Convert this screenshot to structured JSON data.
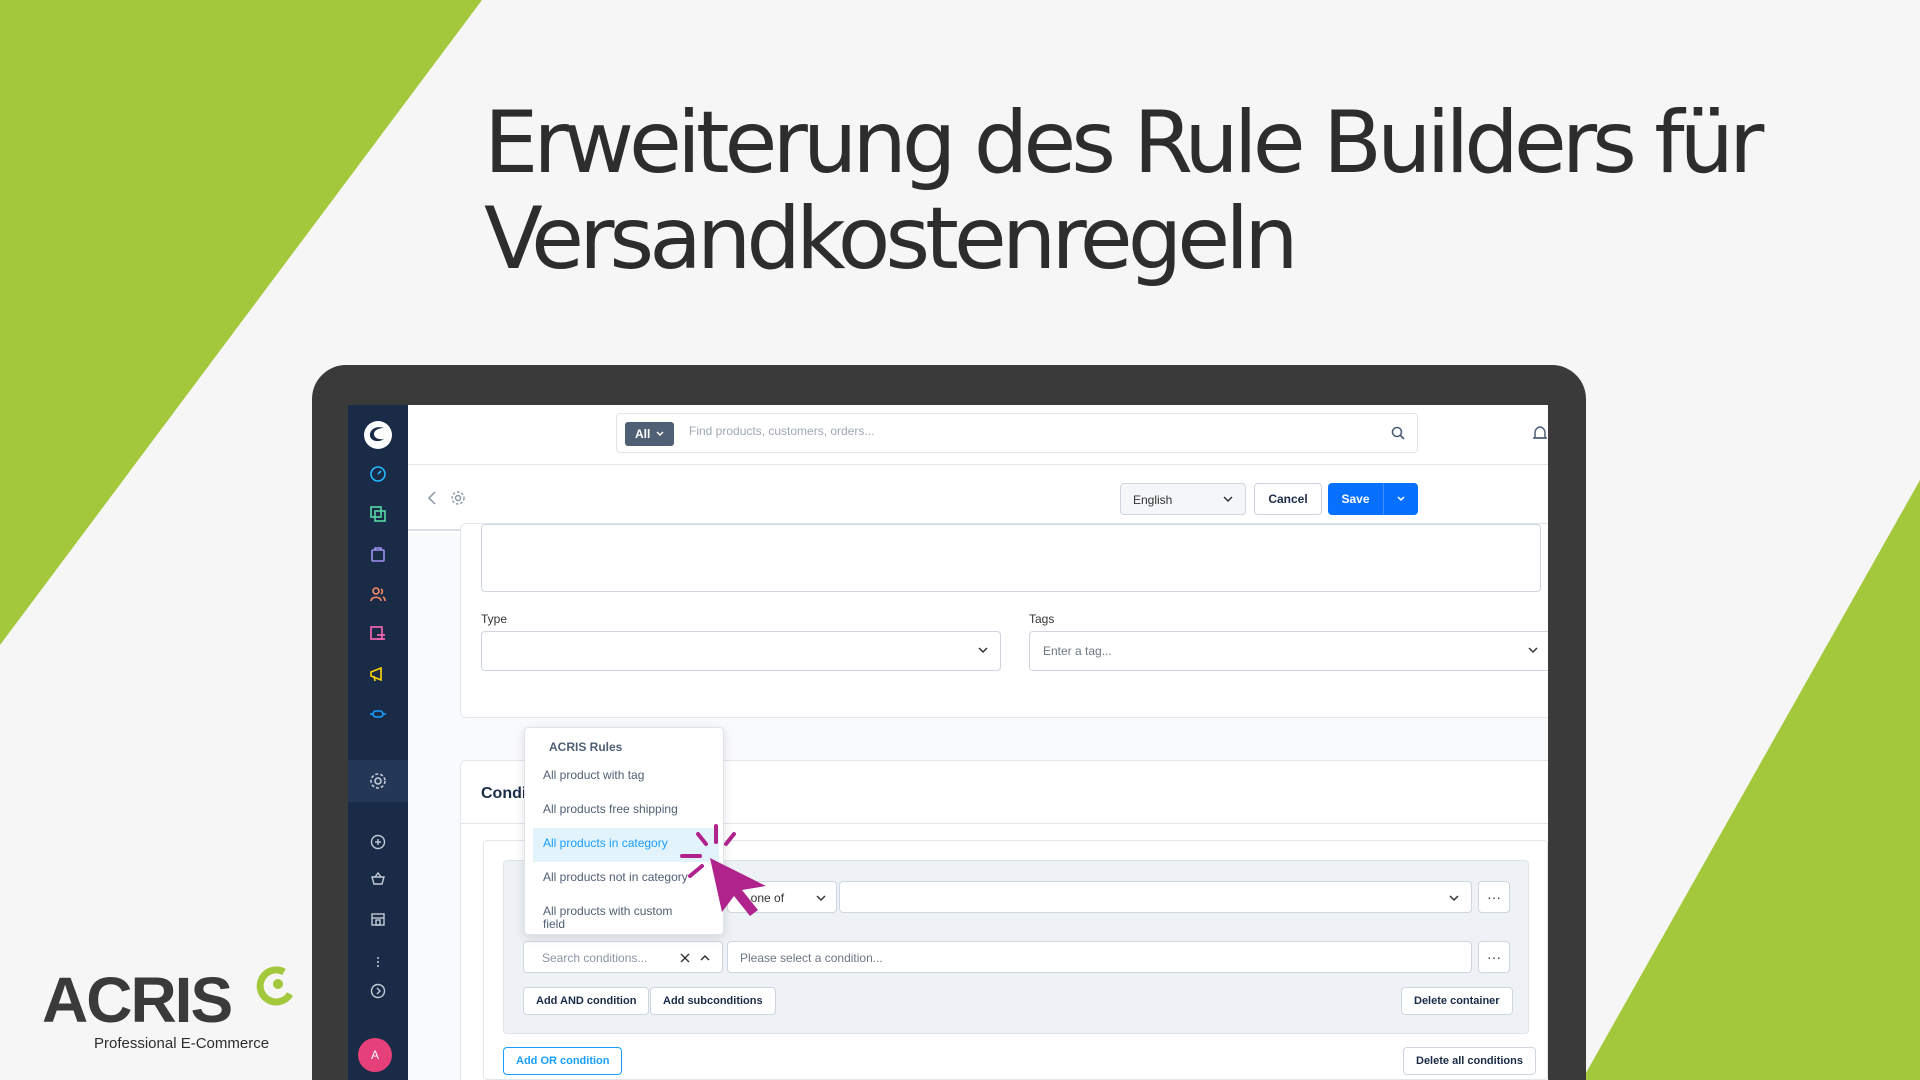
{
  "headline": {
    "line1": "Erweiterung des Rule Builders für",
    "line2": "Versandkostenregeln"
  },
  "logo": {
    "word": "ACRIS",
    "tagline": "Professional E-Commerce"
  },
  "colors": {
    "brand_green": "#a3c83b",
    "sidebar_bg": "#1a2b47",
    "primary_blue": "#0870ff",
    "cursor_magenta": "#b0238c"
  },
  "topbar": {
    "search_type": "All",
    "search_placeholder": "Find products, customers, orders..."
  },
  "smartbar": {
    "language": "English",
    "cancel_label": "Cancel",
    "save_label": "Save"
  },
  "form": {
    "type_label": "Type",
    "tags_label": "Tags",
    "tags_placeholder": "Enter a tag..."
  },
  "conditions": {
    "title": "Condi",
    "operator_value": "Is one of",
    "search_placeholder": "Search conditions...",
    "condition_placeholder": "Please select a condition...",
    "add_and_label": "Add AND condition",
    "add_sub_label": "Add subconditions",
    "delete_container_label": "Delete container",
    "add_or_label": "Add OR condition",
    "delete_all_label": "Delete all conditions",
    "dots": "···"
  },
  "dropdown": {
    "group_title": "ACRIS Rules",
    "items": [
      "All product with tag",
      "All products free shipping",
      "All products in category",
      "All products not in category",
      "All products with custom field"
    ],
    "active_index": 2
  },
  "user": {
    "avatar_initial": "A"
  },
  "icons": [
    "dashboard-icon",
    "catalog-icon",
    "orders-icon",
    "customers-icon",
    "content-icon",
    "marketing-icon",
    "extensions-icon",
    "settings-icon",
    "add-icon",
    "sales-channel-icon",
    "storefront-icon",
    "more-icon",
    "help-icon",
    "search-icon",
    "bell-icon",
    "back-icon",
    "gear-icon",
    "cursor-icon"
  ]
}
